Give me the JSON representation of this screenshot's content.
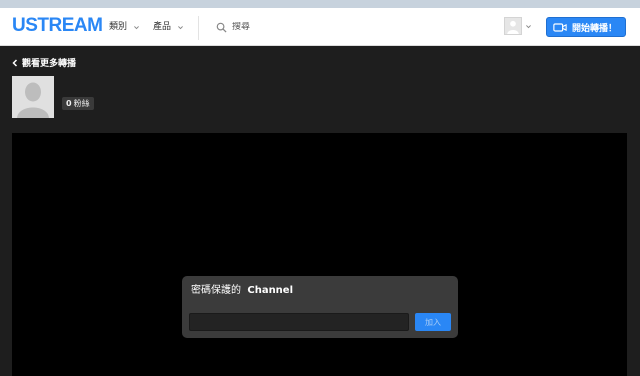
{
  "header": {
    "logo": "USTREAM",
    "nav": {
      "categories_label": "類別",
      "products_label": "產品"
    },
    "search": {
      "placeholder": "搜尋"
    },
    "broadcast_label": "開始轉播！"
  },
  "channel": {
    "back_label": "觀看更多轉播",
    "followers_count": "0",
    "followers_label": "粉絲"
  },
  "password_dialog": {
    "title_prefix": "密碼保護的",
    "channel_name": "Channel",
    "password_value": "",
    "join_label": "加入"
  },
  "colors": {
    "brand_blue": "#2a87f5",
    "page_bg": "#1e1e1e",
    "player_bg": "#000000",
    "dialog_bg": "#3b3b3b"
  },
  "icons": [
    "chevron-down-icon",
    "search-icon",
    "camera-icon",
    "chevron-left-icon",
    "user-silhouette-icon"
  ]
}
